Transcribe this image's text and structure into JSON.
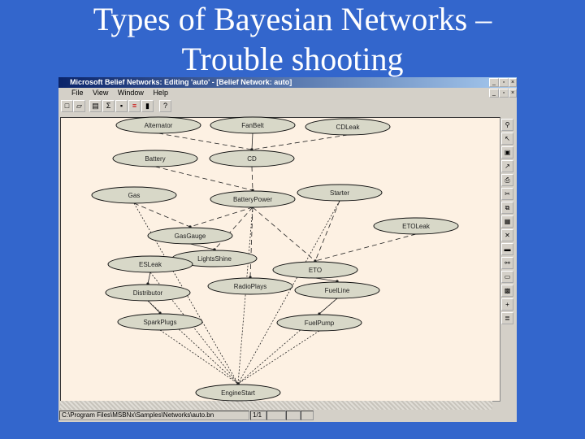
{
  "slide": {
    "title_line1": "Types of Bayesian Networks –",
    "title_line2": "Trouble shooting"
  },
  "window": {
    "title": "Microsoft Belief Networks: Editing 'auto' - [Belief Network: auto]",
    "menu": [
      "File",
      "View",
      "Window",
      "Help"
    ],
    "toolbar_icons": [
      "new-icon",
      "open-icon",
      "properties-icon",
      "sigma-icon",
      "node-icon",
      "list-icon",
      "evaluate-icon",
      "help-icon"
    ],
    "status": {
      "path": "C:\\Program Files\\MSBNx\\Samples\\Networks\\auto.bn",
      "page": "1/1"
    }
  },
  "network": {
    "nodes": [
      "Alternator",
      "FanBelt",
      "CDLeak",
      "Battery",
      "CD",
      "Gas",
      "BatteryPower",
      "Starter",
      "ETOLeak",
      "GasGauge",
      "LightsShine",
      "ESLeak",
      "ETO",
      "Distributor",
      "RadioPlays",
      "FuelLine",
      "SparkPlugs",
      "FuelPump",
      "EngineStart"
    ],
    "edges": [
      [
        "Alternator",
        "CD"
      ],
      [
        "FanBelt",
        "CD"
      ],
      [
        "CDLeak",
        "CD"
      ],
      [
        "Battery",
        "BatteryPower"
      ],
      [
        "CD",
        "BatteryPower"
      ],
      [
        "Gas",
        "GasGauge"
      ],
      [
        "BatteryPower",
        "GasGauge"
      ],
      [
        "GasGauge",
        "LightsShine"
      ],
      [
        "BatteryPower",
        "LightsShine"
      ],
      [
        "BatteryPower",
        "RadioPlays"
      ],
      [
        "BatteryPower",
        "ETO"
      ],
      [
        "Starter",
        "ETO"
      ],
      [
        "ETOLeak",
        "ETO"
      ],
      [
        "ESLeak",
        "Distributor"
      ],
      [
        "Distributor",
        "SparkPlugs"
      ],
      [
        "ETO",
        "FuelLine"
      ],
      [
        "FuelLine",
        "FuelPump"
      ],
      [
        "Gas",
        "EngineStart"
      ],
      [
        "BatteryPower",
        "EngineStart"
      ],
      [
        "Starter",
        "EngineStart"
      ],
      [
        "ESLeak",
        "EngineStart"
      ],
      [
        "Distributor",
        "EngineStart"
      ],
      [
        "SparkPlugs",
        "EngineStart"
      ],
      [
        "FuelLine",
        "EngineStart"
      ],
      [
        "FuelPump",
        "EngineStart"
      ]
    ]
  }
}
